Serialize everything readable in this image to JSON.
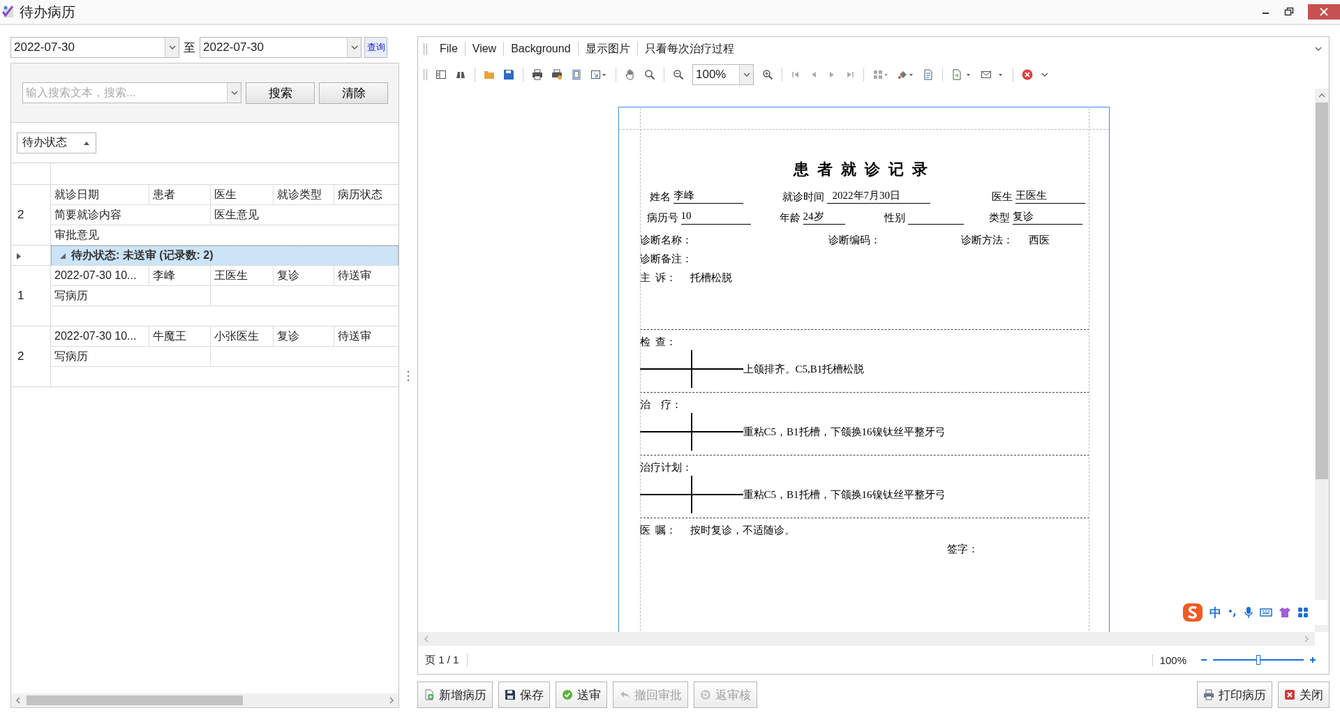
{
  "window": {
    "title": "待办病历"
  },
  "date_range": {
    "from": "2022-07-30",
    "separator": "至",
    "to": "2022-07-30",
    "query_button": "查询"
  },
  "search": {
    "placeholder": "输入搜索文本，搜索...",
    "buttons": [
      "搜索",
      "清除"
    ]
  },
  "group_panel": {
    "chip": "待办状态"
  },
  "grid": {
    "header_number": "2",
    "header_columns": [
      "就诊日期",
      "患者",
      "医生",
      "就诊类型",
      "病历状态"
    ],
    "header_row_2": [
      "简要就诊内容",
      "医生意见"
    ],
    "header_row_3": "审批意见",
    "group_row": {
      "label": "待办状态: 未送审 (记录数: 2)",
      "expanded": true,
      "selected": true
    },
    "records": [
      {
        "number": "1",
        "cells": [
          "2022-07-30 10...",
          "李峰",
          "王医生",
          "复诊",
          "待送审"
        ],
        "summary": "写病历"
      },
      {
        "number": "2",
        "cells": [
          "2022-07-30 10...",
          "牛魔王",
          "小张医生",
          "复诊",
          "待送审"
        ],
        "summary": "写病历"
      }
    ]
  },
  "viewer": {
    "menu": [
      "File",
      "View",
      "Background",
      "显示图片",
      "只看每次治疗过程"
    ],
    "zoom_value": "100%",
    "document": {
      "title": "患者就诊记录",
      "info_row_1": [
        {
          "label": "姓名",
          "value": "李峰"
        },
        {
          "label": "就诊时间",
          "value": "2022年7月30日"
        },
        {
          "label": "医生",
          "value": "王医生"
        }
      ],
      "info_row_2": [
        {
          "label": "病历号",
          "value": "10"
        },
        {
          "label": "年龄",
          "value": "24岁"
        },
        {
          "label": "性别"
        },
        {
          "label": "类型",
          "value": "复诊"
        }
      ],
      "diagnosis": [
        {
          "label": "诊断名称："
        },
        {
          "label": "诊断编码："
        },
        {
          "label": "诊断方法：",
          "value": "西医"
        }
      ],
      "note_label": "诊断备注：",
      "complaint": {
        "label": "主  诉：",
        "value": "托槽松脱"
      },
      "sections": [
        {
          "label": "检  查：",
          "text": "上颌排齐。C5,B1托槽松脱"
        },
        {
          "label": "治    疗：",
          "text": "重粘C5，B1托槽，下颌换16镍钛丝平整牙弓"
        },
        {
          "label": "治疗计划：",
          "text": "重粘C5，B1托槽，下颌换16镍钛丝平整牙弓"
        }
      ],
      "advice": {
        "label": "医  嘱：",
        "value": "按时复诊，不适随诊。"
      },
      "signature": "签字："
    },
    "status": {
      "page": "页 1 / 1",
      "zoom": "100%"
    },
    "zoom_slider": {
      "level": 0.5
    }
  },
  "left_buttons": [
    {
      "label": "新增病历",
      "kind": "add",
      "disabled": false
    },
    {
      "label": "保存",
      "kind": "save",
      "disabled": false
    },
    {
      "label": "送审",
      "kind": "submit",
      "disabled": false
    },
    {
      "label": "撤回审批",
      "kind": "undo",
      "disabled": true
    },
    {
      "label": "返审核",
      "kind": "return",
      "disabled": true
    }
  ],
  "right_buttons": [
    {
      "label": "打印病历",
      "kind": "print",
      "disabled": false
    },
    {
      "label": "关闭",
      "kind": "close",
      "disabled": false
    }
  ],
  "ime": {
    "label": "中"
  }
}
